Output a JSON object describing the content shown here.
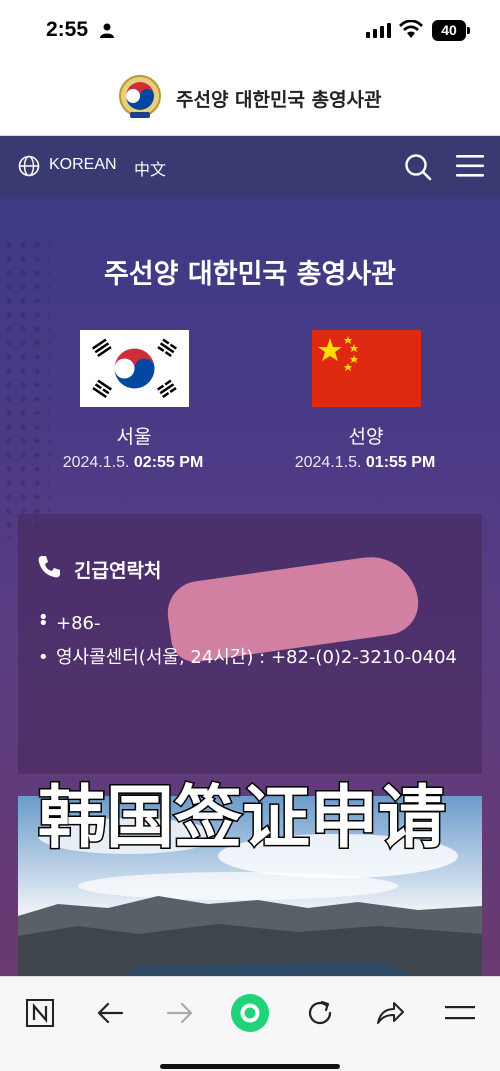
{
  "status": {
    "time": "2:55",
    "battery": "40"
  },
  "header": {
    "title": "주선양 대한민국 총영사관"
  },
  "nav": {
    "lang_korean": "KOREAN",
    "lang_chinese": "中文"
  },
  "hero": {
    "title": "주선양 대한민국 총영사관",
    "clocks": [
      {
        "city": "서울",
        "date": "2024.1.5.",
        "time": "02:55 PM"
      },
      {
        "city": "선양",
        "date": "2024.1.5.",
        "time": "01:55 PM"
      }
    ]
  },
  "emergency": {
    "title": "긴급연락처",
    "items": [
      "",
      "+86-",
      "영사콜센터(서울, 24시간) : +82-(0)2-3210-0404"
    ]
  },
  "overlay": {
    "text": "韩国签证申请"
  },
  "browser_bar": {
    "icons": [
      "naver-n-icon",
      "back-arrow-icon",
      "forward-arrow-icon",
      "green-home-icon",
      "refresh-icon",
      "share-icon",
      "menu-icon"
    ]
  }
}
